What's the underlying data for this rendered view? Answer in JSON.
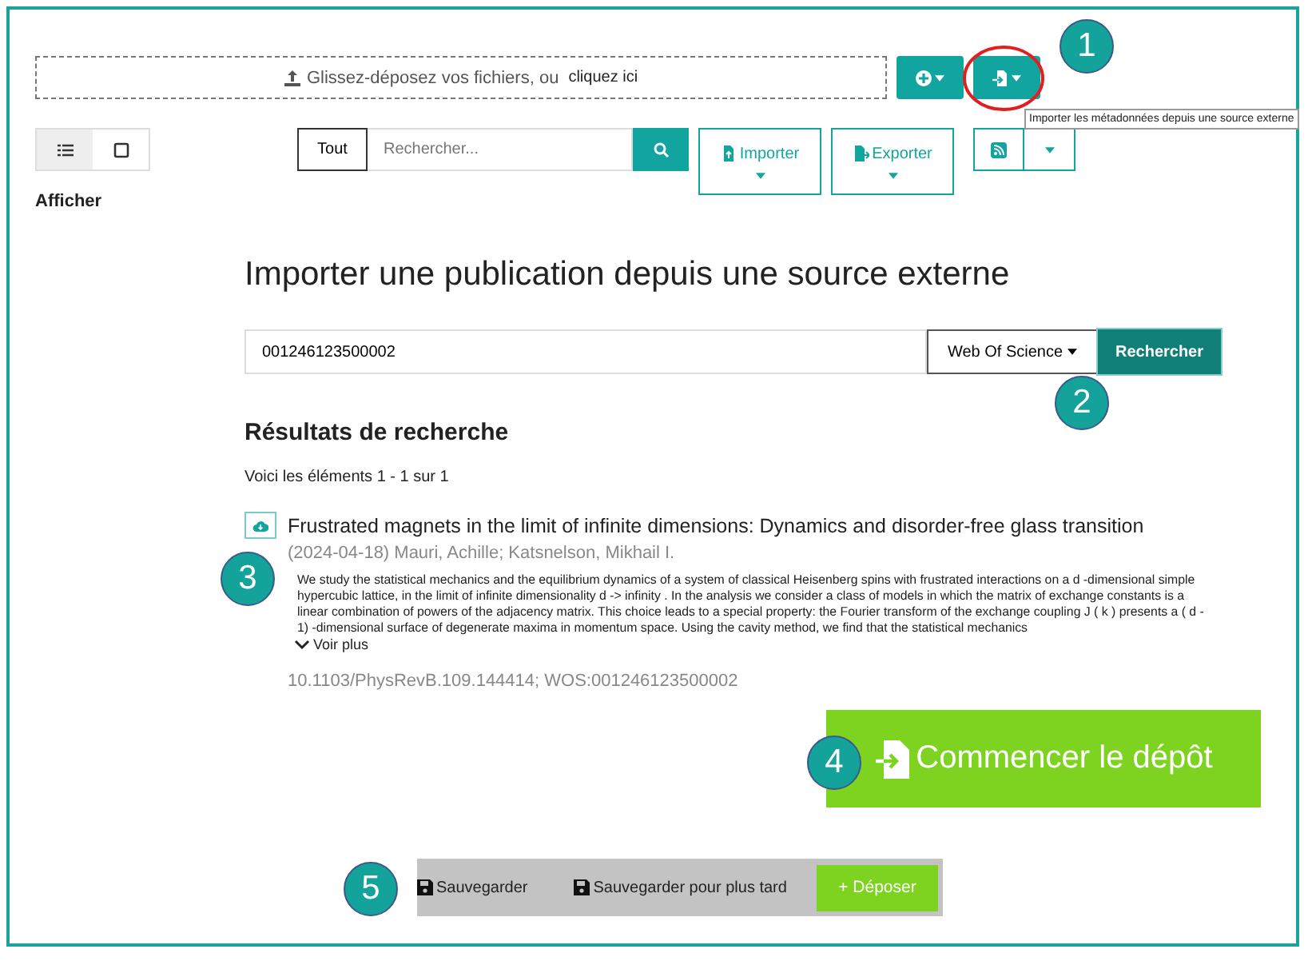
{
  "upload": {
    "drop_text": "Glissez-déposez vos fichiers, ou",
    "link": "cliquez ici"
  },
  "tooltip": "Importer les métadonnées depuis une source externe",
  "view_toggle": [
    {
      "selected": true
    },
    {
      "selected": false
    }
  ],
  "search": {
    "scope": "Tout",
    "placeholder": "Rechercher..."
  },
  "import_button": "Importer",
  "export_button": "Exporter",
  "display_label": "Afficher",
  "import_panel": {
    "title": "Importer une publication depuis une source externe",
    "query": "001246123500002",
    "source": "Web Of Science",
    "search_button": "Rechercher"
  },
  "results": {
    "heading": "Résultats de recherche",
    "summary": "Voici les éléments 1 - 1 sur 1",
    "items": [
      {
        "title": "Frustrated magnets in the limit of infinite dimensions: Dynamics and disorder-free glass transition",
        "meta": "(2024-04-18) Mauri, Achille; Katsnelson, Mikhail I.",
        "abstract": "We study the statistical mechanics and the equilibrium dynamics of a system of classical Heisenberg spins with frustrated interactions on a d -dimensional simple hypercubic lattice, in the limit of infinite dimensionality d -> infinity . In the analysis we consider a class of models in which the matrix of exchange constants is a linear combination of powers of the adjacency matrix. This choice leads to a special property: the Fourier transform of the exchange coupling J ( k ) presents a ( d - 1) -dimensional surface of degenerate maxima in momentum space. Using the cavity method, we find that the statistical mechanics",
        "more": "Voir plus",
        "ids": "10.1103/PhysRevB.109.144414; WOS:001246123500002"
      }
    ]
  },
  "start_button": "Commencer le dépôt",
  "footer": {
    "save": "Sauvegarder",
    "save_later": "Sauvegarder pour plus tard",
    "deposit": "+ Déposer"
  },
  "callouts": [
    "1",
    "2",
    "3",
    "4",
    "5"
  ]
}
